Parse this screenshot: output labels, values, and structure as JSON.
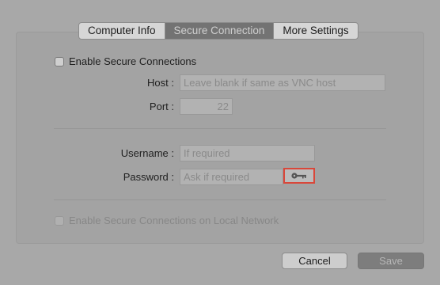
{
  "tabs": [
    {
      "label": "Computer Info"
    },
    {
      "label": "Secure Connection"
    },
    {
      "label": "More Settings"
    }
  ],
  "secure": {
    "enable_label": "Enable Secure Connections",
    "host_label": "Host :",
    "host_placeholder": "Leave blank if same as VNC host",
    "port_label": "Port :",
    "port_value": "22"
  },
  "auth": {
    "username_label": "Username :",
    "username_placeholder": "If required",
    "password_label": "Password :",
    "password_placeholder": "Ask if required"
  },
  "local": {
    "enable_label": "Enable Secure Connections on Local Network"
  },
  "buttons": {
    "cancel": "Cancel",
    "save": "Save"
  },
  "colors": {
    "highlight": "#d9473a"
  }
}
